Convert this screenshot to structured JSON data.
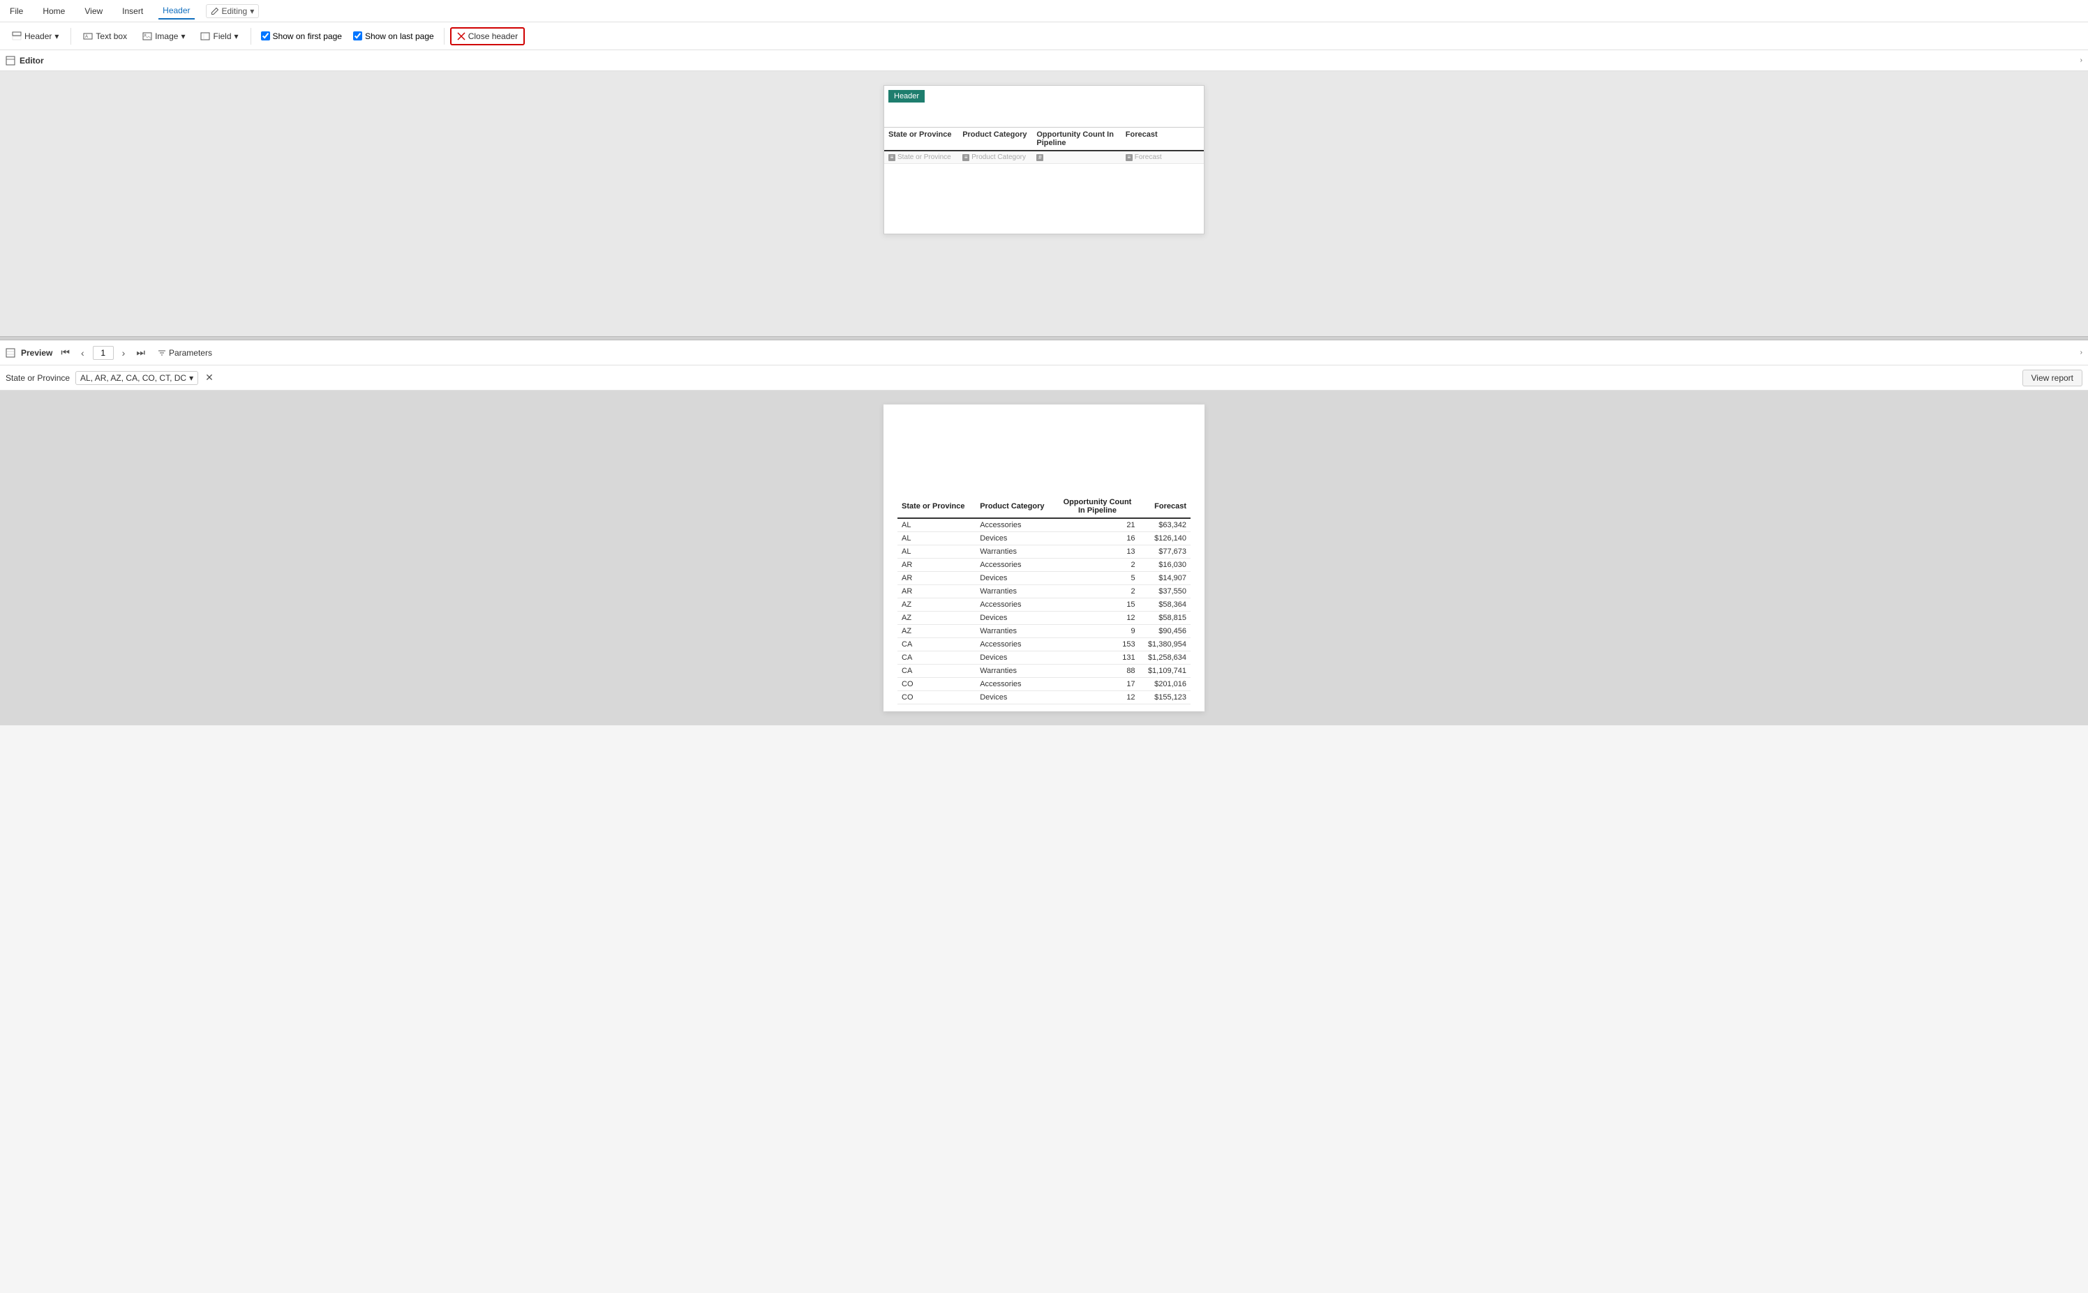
{
  "menuBar": {
    "items": [
      {
        "label": "File",
        "active": false
      },
      {
        "label": "Home",
        "active": false
      },
      {
        "label": "View",
        "active": false
      },
      {
        "label": "Insert",
        "active": false
      },
      {
        "label": "Header",
        "active": true
      }
    ],
    "editingBadge": "Editing"
  },
  "toolbar": {
    "headerBtn": "Header",
    "textBoxBtn": "Text box",
    "imageBtn": "Image",
    "fieldBtn": "Field",
    "showFirstPage": "Show on first page",
    "showLastPage": "Show on last page",
    "closeHeader": "Close header"
  },
  "sectionBar": {
    "title": "Editor"
  },
  "canvas": {
    "headerLabel": "Header",
    "columns": [
      "State or Province",
      "Product Category",
      "Opportunity Count In Pipeline",
      "Forecast"
    ],
    "dataRow": [
      "State or Province",
      "Product Category",
      "",
      "Forecast"
    ]
  },
  "previewBar": {
    "title": "Preview",
    "page": "1",
    "parametersBtn": "Parameters"
  },
  "paramsBar": {
    "label": "State or Province",
    "value": "AL, AR, AZ, CA, CO, CT, DC",
    "viewReportBtn": "View report"
  },
  "previewTable": {
    "columns": [
      "State or Province",
      "Product Category",
      "Opportunity Count In Pipeline",
      "Forecast"
    ],
    "rows": [
      {
        "state": "AL",
        "category": "Accessories",
        "count": "21",
        "forecast": "$63,342"
      },
      {
        "state": "AL",
        "category": "Devices",
        "count": "16",
        "forecast": "$126,140"
      },
      {
        "state": "AL",
        "category": "Warranties",
        "count": "13",
        "forecast": "$77,673"
      },
      {
        "state": "AR",
        "category": "Accessories",
        "count": "2",
        "forecast": "$16,030"
      },
      {
        "state": "AR",
        "category": "Devices",
        "count": "5",
        "forecast": "$14,907"
      },
      {
        "state": "AR",
        "category": "Warranties",
        "count": "2",
        "forecast": "$37,550"
      },
      {
        "state": "AZ",
        "category": "Accessories",
        "count": "15",
        "forecast": "$58,364"
      },
      {
        "state": "AZ",
        "category": "Devices",
        "count": "12",
        "forecast": "$58,815"
      },
      {
        "state": "AZ",
        "category": "Warranties",
        "count": "9",
        "forecast": "$90,456"
      },
      {
        "state": "CA",
        "category": "Accessories",
        "count": "153",
        "forecast": "$1,380,954"
      },
      {
        "state": "CA",
        "category": "Devices",
        "count": "131",
        "forecast": "$1,258,634"
      },
      {
        "state": "CA",
        "category": "Warranties",
        "count": "88",
        "forecast": "$1,109,741"
      },
      {
        "state": "CO",
        "category": "Accessories",
        "count": "17",
        "forecast": "$201,016"
      },
      {
        "state": "CO",
        "category": "Devices",
        "count": "12",
        "forecast": "$155,123"
      }
    ]
  }
}
